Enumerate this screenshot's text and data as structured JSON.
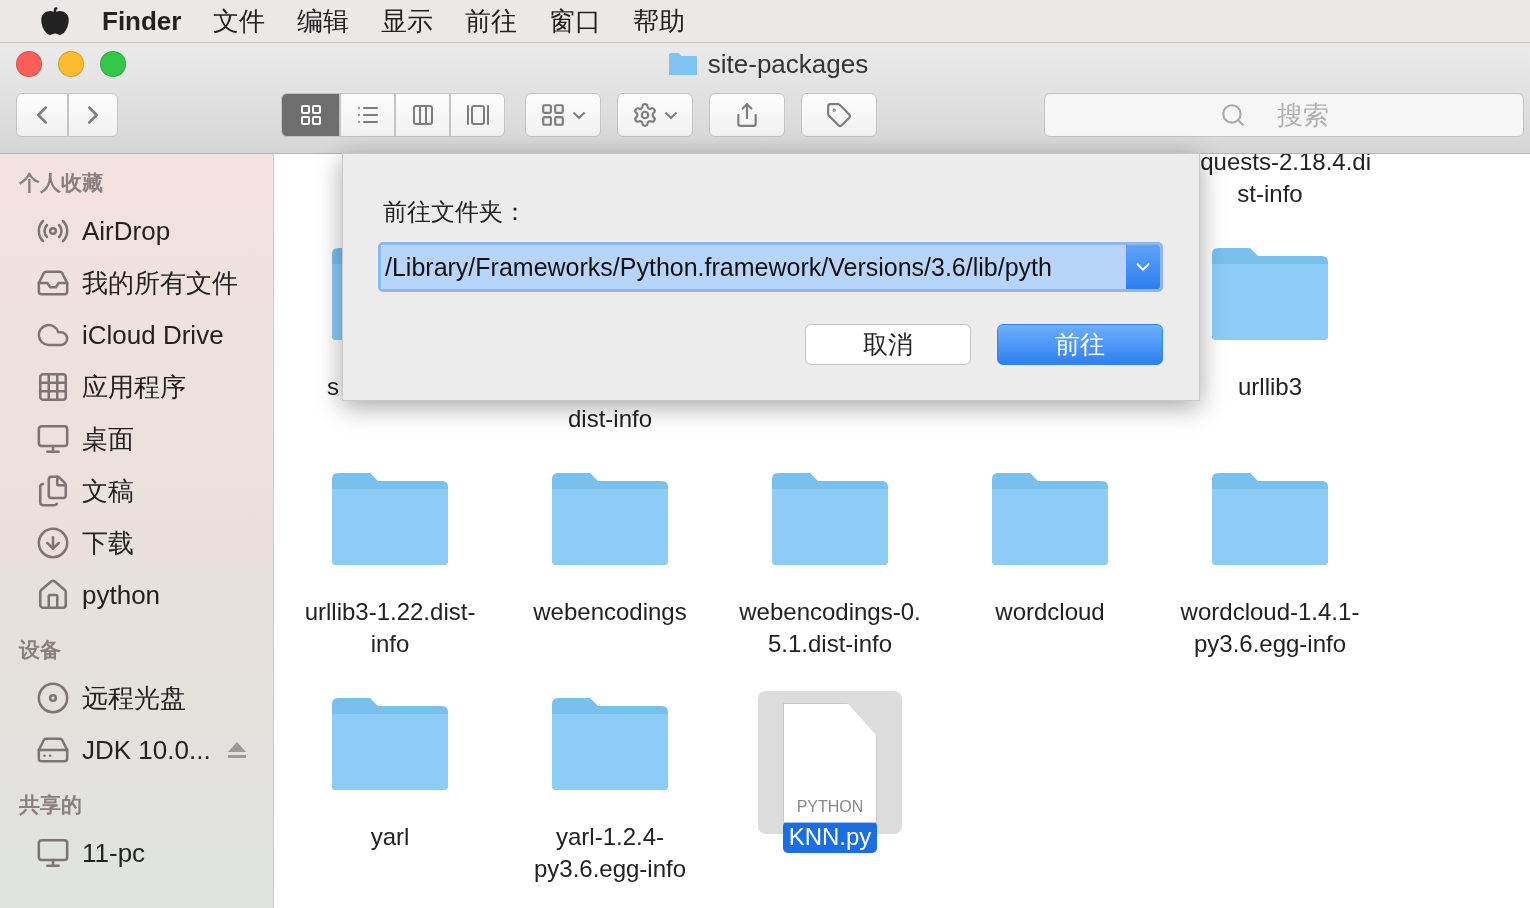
{
  "menu_bar": {
    "app": "Finder",
    "items": [
      "文件",
      "编辑",
      "显示",
      "前往",
      "窗口",
      "帮助"
    ]
  },
  "window": {
    "title": "site-packages"
  },
  "toolbar": {
    "view_modes": [
      {
        "kind": "icons",
        "selected": true
      },
      {
        "kind": "list",
        "selected": false
      },
      {
        "kind": "columns",
        "selected": false
      },
      {
        "kind": "gallery",
        "selected": false
      }
    ],
    "search": {
      "placeholder": "搜索"
    }
  },
  "sidebar": {
    "sections": [
      {
        "title": "个人收藏",
        "items": [
          {
            "kind": "airdrop",
            "label": "AirDrop"
          },
          {
            "kind": "allfiles",
            "label": "我的所有文件"
          },
          {
            "kind": "cloud",
            "label": "iCloud Drive"
          },
          {
            "kind": "apps",
            "label": "应用程序"
          },
          {
            "kind": "desktop",
            "label": "桌面"
          },
          {
            "kind": "docs",
            "label": "文稿"
          },
          {
            "kind": "downloads",
            "label": "下载"
          },
          {
            "kind": "home",
            "label": "python"
          }
        ]
      },
      {
        "title": "设备",
        "items": [
          {
            "kind": "disc",
            "label": "远程光盘"
          },
          {
            "kind": "drive",
            "label": "JDK 10.0...",
            "ejectable": true
          }
        ]
      },
      {
        "title": "共享的",
        "items": [
          {
            "kind": "computer",
            "label": "11-pc"
          }
        ]
      }
    ]
  },
  "files": [
    {
      "kind": "hidden"
    },
    {
      "kind": "hidden"
    },
    {
      "kind": "hidden"
    },
    {
      "kind": "hidden"
    },
    {
      "kind": "start_hidden",
      "lines": [
        "quests-2.18.4.di",
        "st-info"
      ],
      "selected": false
    },
    {
      "kind": "head_only",
      "lines": [
        "s"
      ],
      "selected": false
    },
    {
      "kind": "tail_only",
      "lines": [
        "dist-info"
      ],
      "selected": false
    },
    {
      "kind": "hidden"
    },
    {
      "kind": "hidden"
    },
    {
      "kind": "folder",
      "lines": [
        "urllib3"
      ],
      "selected": false
    },
    {
      "kind": "folder",
      "lines": [
        "urllib3-1.22.dist-",
        "info"
      ],
      "selected": false
    },
    {
      "kind": "folder",
      "lines": [
        "webencodings"
      ],
      "selected": false
    },
    {
      "kind": "folder",
      "lines": [
        "webencodings-0.",
        "5.1.dist-info"
      ],
      "selected": false
    },
    {
      "kind": "folder",
      "lines": [
        "wordcloud"
      ],
      "selected": false
    },
    {
      "kind": "folder",
      "lines": [
        "wordcloud-1.4.1-",
        "py3.6.egg-info"
      ],
      "selected": false
    },
    {
      "kind": "folder",
      "lines": [
        "yarl"
      ],
      "selected": false
    },
    {
      "kind": "folder",
      "lines": [
        "yarl-1.2.4-",
        "py3.6.egg-info"
      ],
      "selected": false
    },
    {
      "kind": "file",
      "lines": [
        "KNN.py"
      ],
      "file_type": "PYTHON",
      "selected": true
    }
  ],
  "dialog": {
    "label": "前往文件夹：",
    "value": "/Library/Frameworks/Python.framework/Versions/3.6/lib/pyth",
    "buttons": [
      {
        "label": "取消",
        "default": false
      },
      {
        "label": "前往",
        "default": true
      }
    ]
  }
}
